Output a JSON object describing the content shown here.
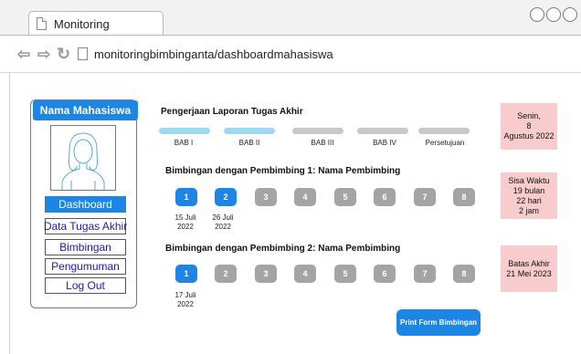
{
  "browser": {
    "tab_title": "Monitoring",
    "url": "monitoringbimbinganta/dashboardmahasiswa"
  },
  "sidebar": {
    "title": "Nama Mahasiswa",
    "menu": [
      {
        "label": "Dashboard",
        "active": true
      },
      {
        "label": "Data Tugas Akhir",
        "active": false
      },
      {
        "label": "Bimbingan",
        "active": false
      },
      {
        "label": "Pengumuman",
        "active": false
      },
      {
        "label": "Log Out",
        "active": false
      }
    ]
  },
  "progress": {
    "title": "Pengerjaan Laporan Tugas Akhir",
    "stages": [
      {
        "label": "BAB I",
        "done": true
      },
      {
        "label": "BAB II",
        "done": true
      },
      {
        "label": "BAB III",
        "done": false
      },
      {
        "label": "BAB IV",
        "done": false
      },
      {
        "label": "Persetujuan",
        "done": false
      }
    ]
  },
  "supervisor1": {
    "title": "Bimbingan dengan Pembimbing 1: Nama Pembimbing",
    "steps": [
      "1",
      "2",
      "3",
      "4",
      "5",
      "6",
      "7",
      "8"
    ],
    "completed": 2,
    "dates": [
      [
        "15 Juli",
        "2022"
      ],
      [
        "26 Juli",
        "2022"
      ]
    ]
  },
  "supervisor2": {
    "title": "Bimbingan dengan Pembimbing 2: Nama Pembimbing",
    "steps": [
      "1",
      "2",
      "3",
      "4",
      "5",
      "6",
      "7",
      "8"
    ],
    "completed": 1,
    "dates": [
      [
        "17 Juli",
        "2022"
      ]
    ]
  },
  "info": {
    "date": "Senin,\n8\nAgustus 2022",
    "remaining": "Sisa Waktu\n19 bulan\n22 hari\n2 jam",
    "deadline": "Batas Akhir\n21 Mei 2023"
  },
  "actions": {
    "print_label": "Print Form Bimbingan"
  },
  "colors": {
    "accent": "#1d86e5",
    "progress_done": "#9fd8f2",
    "progress_todo": "#c8c8c8",
    "step_todo": "#a4a4a4",
    "info_bg": "#f8cccc"
  }
}
